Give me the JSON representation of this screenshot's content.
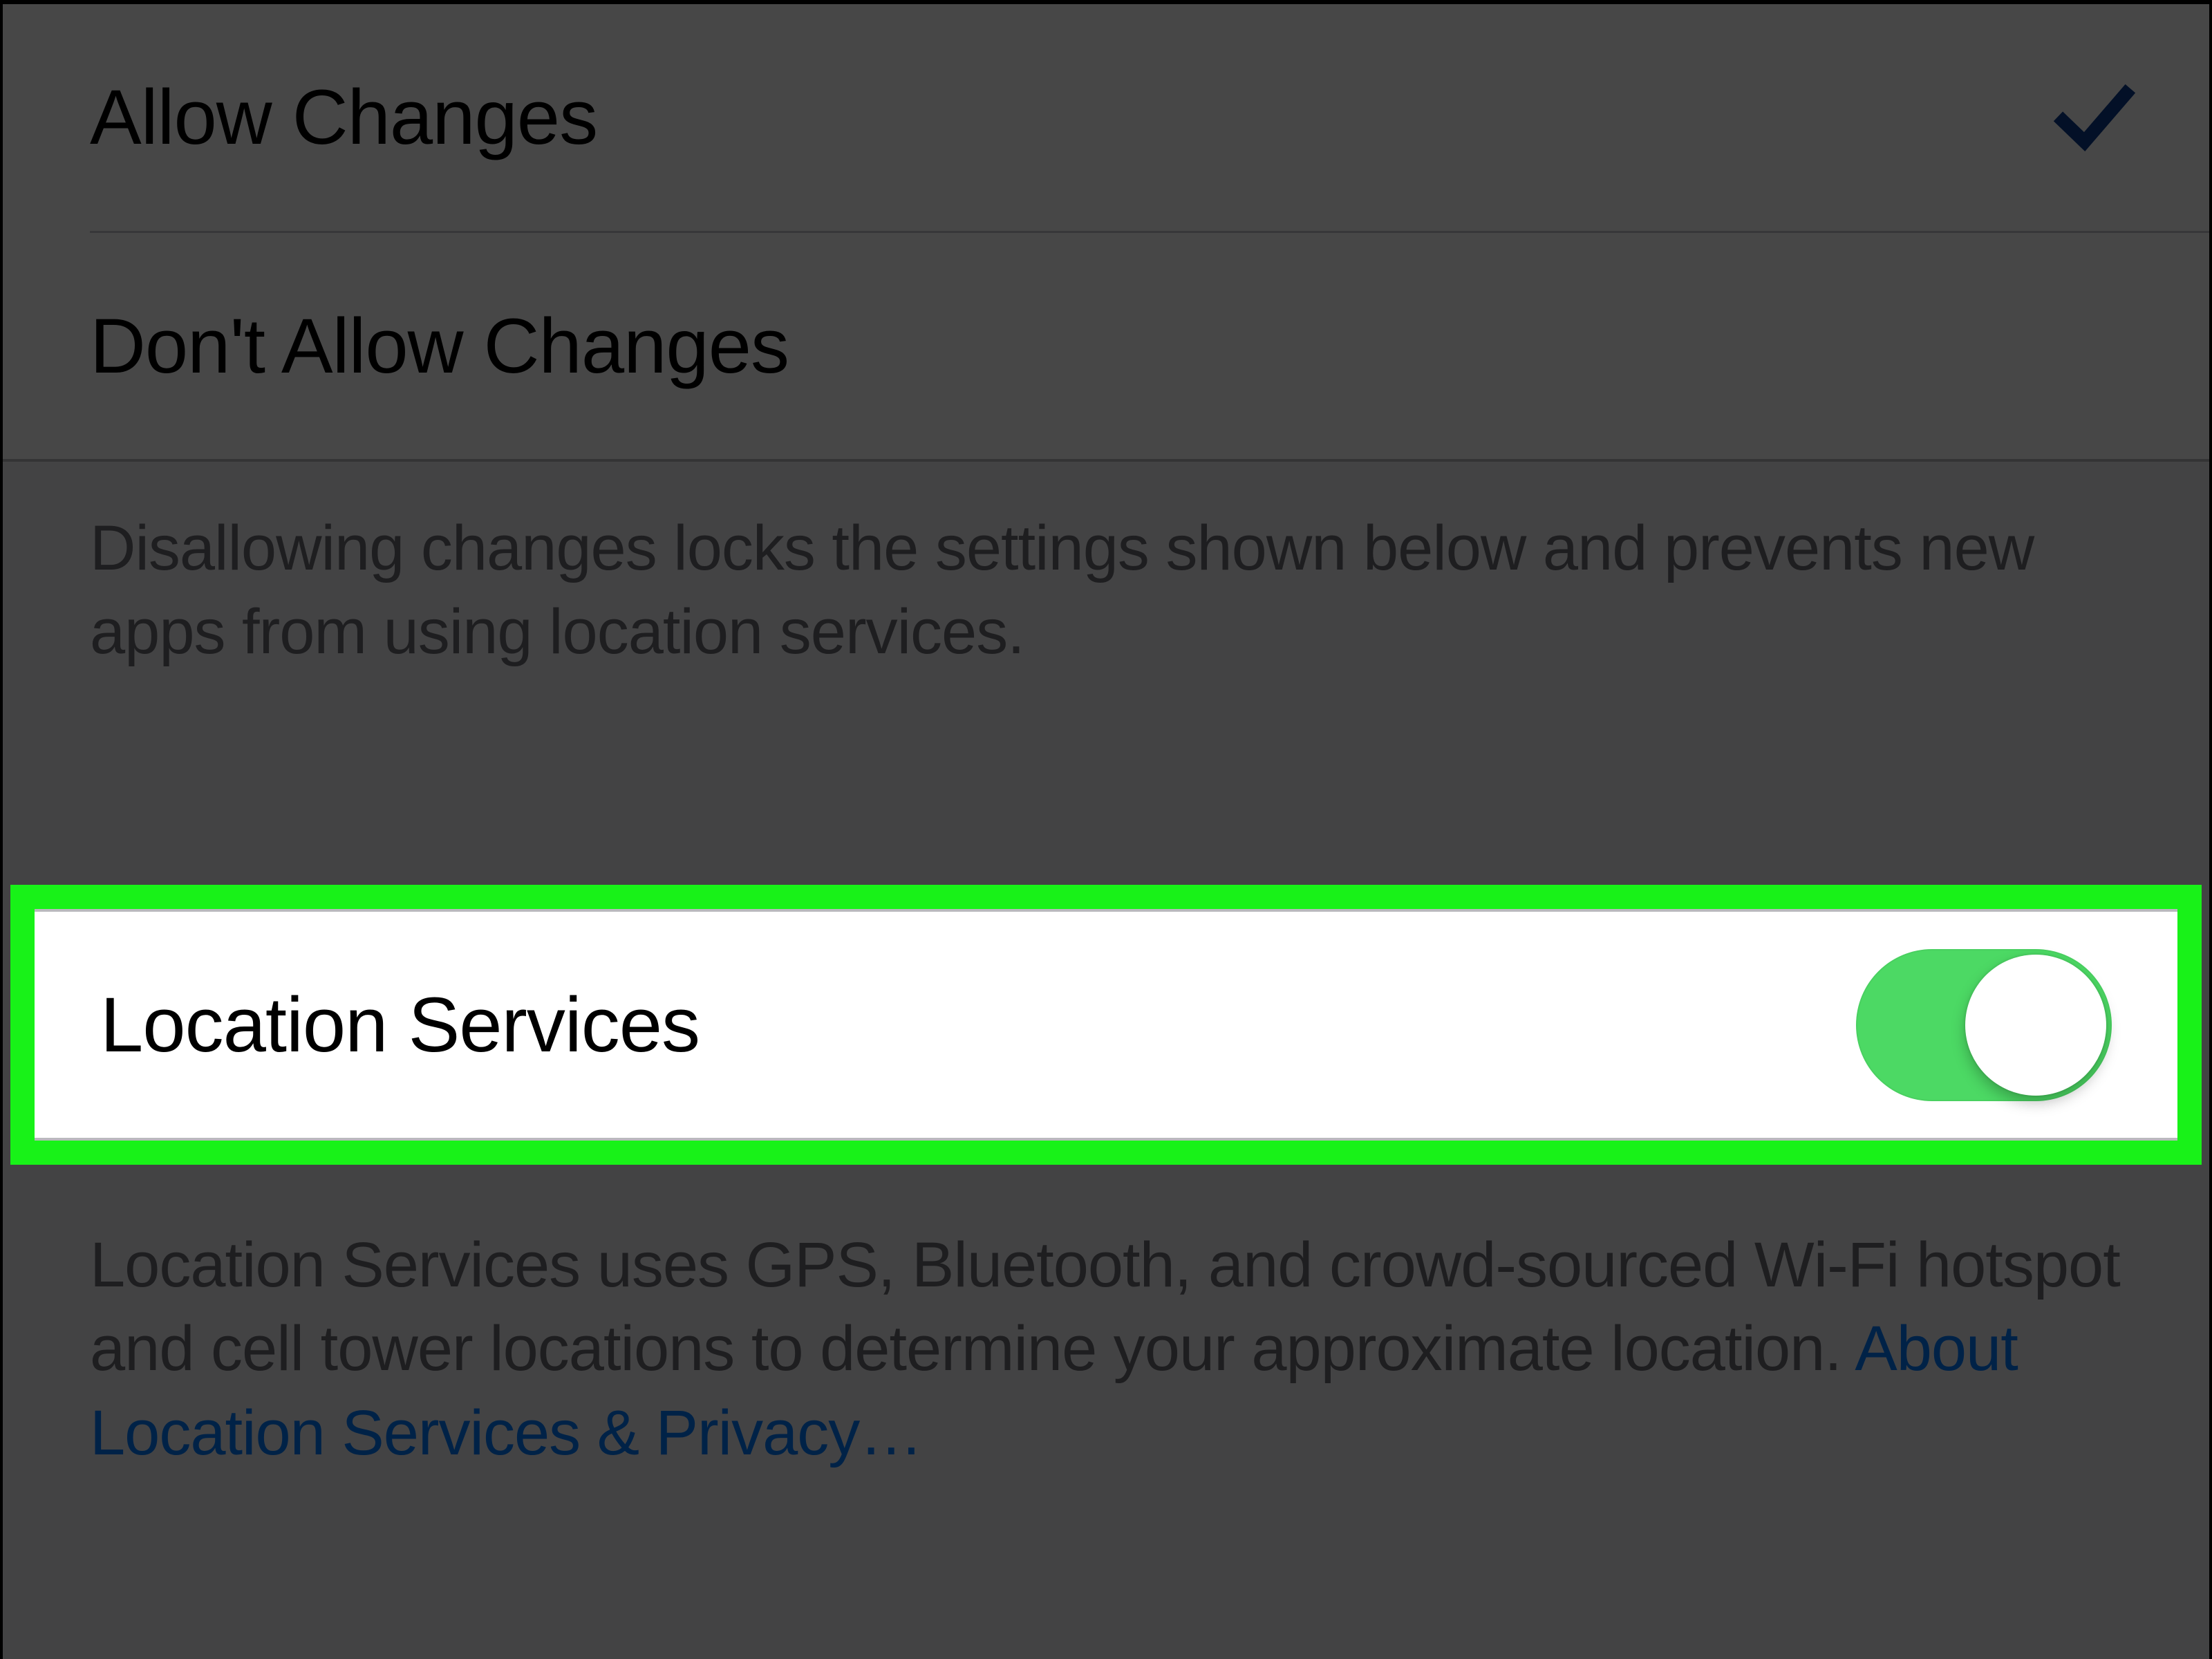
{
  "changes_group": {
    "allow_label": "Allow Changes",
    "allow_selected": true,
    "dont_allow_label": "Don't Allow Changes",
    "footer": "Disallowing changes locks the settings shown below and prevents new apps from using location services."
  },
  "location_services": {
    "label": "Location Services",
    "toggle_on": true,
    "footer_text": "Location Services uses GPS, Bluetooth, and crowd-sourced Wi-Fi hotspot and cell tower locations to determine your approximate location. ",
    "link_text": "About Location Services & Privacy…"
  },
  "colors": {
    "highlight_border": "#18f218",
    "toggle_on_fill": "#4cd964",
    "link": "#007aff",
    "checkmark": "#0b3b8c"
  }
}
